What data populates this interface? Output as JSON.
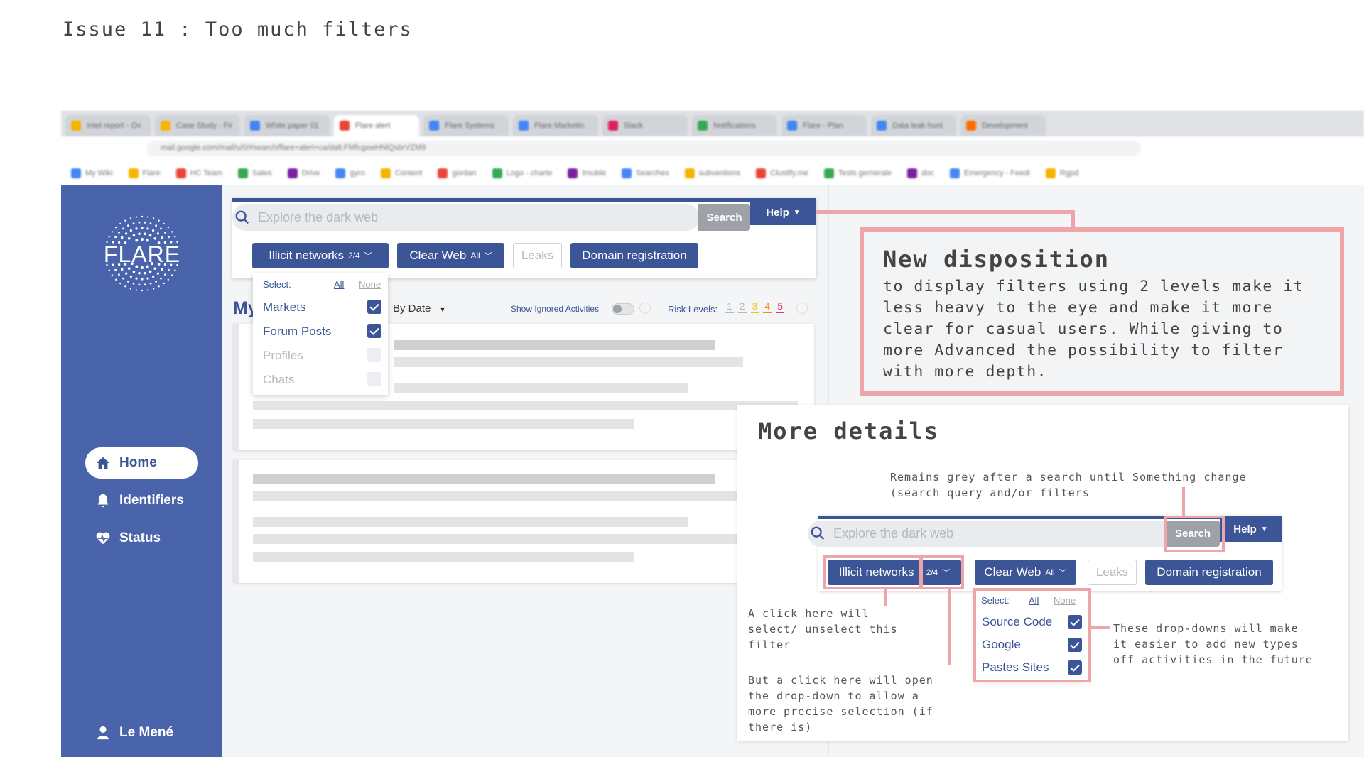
{
  "title": "Issue 11 : Too much filters",
  "browser": {
    "tabs": [
      "Intel report - Ov",
      "Case Study - Fir",
      "White paper 01",
      "Flare alert",
      "Flare Systems",
      "Flare Marketin",
      "Slack",
      "Notifications",
      "Flare - Plan",
      "Data leak hunt",
      "Development"
    ],
    "url": "mail.google.com/mail/u/0/#search/flare+alert+ca/dalt:FMfcgxwHNlQsbrVZM9",
    "bookmarks": [
      "My Wiki",
      "Flare",
      "HC Team",
      "Sales",
      "Drive",
      "gyro",
      "Content",
      "gordan",
      "Logo - charte",
      "trouble",
      "Searches",
      "subventions",
      "Clustify.me",
      "Tests gernerale",
      "doc",
      "Emergency - Feedi",
      "Rgpd"
    ]
  },
  "sidebar": {
    "logo_text": "FLARE",
    "nav": [
      {
        "label": "Home",
        "icon": "home-icon"
      },
      {
        "label": "Identifiers",
        "icon": "bell-icon"
      },
      {
        "label": "Status",
        "icon": "heart-pulse-icon"
      }
    ],
    "user": "Le Mené"
  },
  "main": {
    "search_placeholder": "Explore the dark web",
    "search_label": "Search",
    "help_label": "Help",
    "filters": {
      "illicit": {
        "label": "Illicit networks",
        "count": "2/4"
      },
      "clearweb": {
        "label": "Clear Web",
        "count": "All"
      },
      "leaks": {
        "label": "Leaks"
      },
      "domain": {
        "label": "Domain registration"
      }
    },
    "dropdown": {
      "select_label": "Select:",
      "all": "All",
      "none": "None",
      "items": [
        {
          "label": "Markets",
          "checked": true
        },
        {
          "label": "Forum Posts",
          "checked": true
        },
        {
          "label": "Profiles",
          "checked": false
        },
        {
          "label": "Chats",
          "checked": false
        }
      ]
    },
    "heading_partial": "My",
    "sort_label": "By Date",
    "show_ignored": "Show Ignored Activities",
    "risk_label": "Risk Levels:",
    "risk_levels": [
      "1",
      "2",
      "3",
      "4",
      "5"
    ]
  },
  "new_disposition": {
    "title": "New disposition",
    "body": "to display filters using  2 levels  make it less heavy to the eye and make it more clear for casual users. While giving to more Advanced  the possibility to filter with more depth."
  },
  "details": {
    "title": "More details",
    "note_search": "Remains grey after a search until Something change\n(search query and/or filters",
    "note_click": "A click here will\nselect/ unselect this\nfilter",
    "note_open": "But a click here will open\nthe drop-down to allow a\nmore precise selection (if\nthere is)",
    "note_dropdowns": "These drop-downs will make\nit easier to add new types\noff activities in the future",
    "dropdown": {
      "select_label": "Select:",
      "all": "All",
      "none": "None",
      "items": [
        {
          "label": "Source Code",
          "checked": true
        },
        {
          "label": "Google",
          "checked": true
        },
        {
          "label": "Pastes Sites",
          "checked": true
        }
      ]
    }
  },
  "colors": {
    "brand": "#3b5596",
    "sidebar": "#4a64ac",
    "annotation": "#eda5a8",
    "risk": [
      "#b5b8be",
      "#b5b8be",
      "#f2c21b",
      "#f28b1b",
      "#e5336e"
    ]
  }
}
